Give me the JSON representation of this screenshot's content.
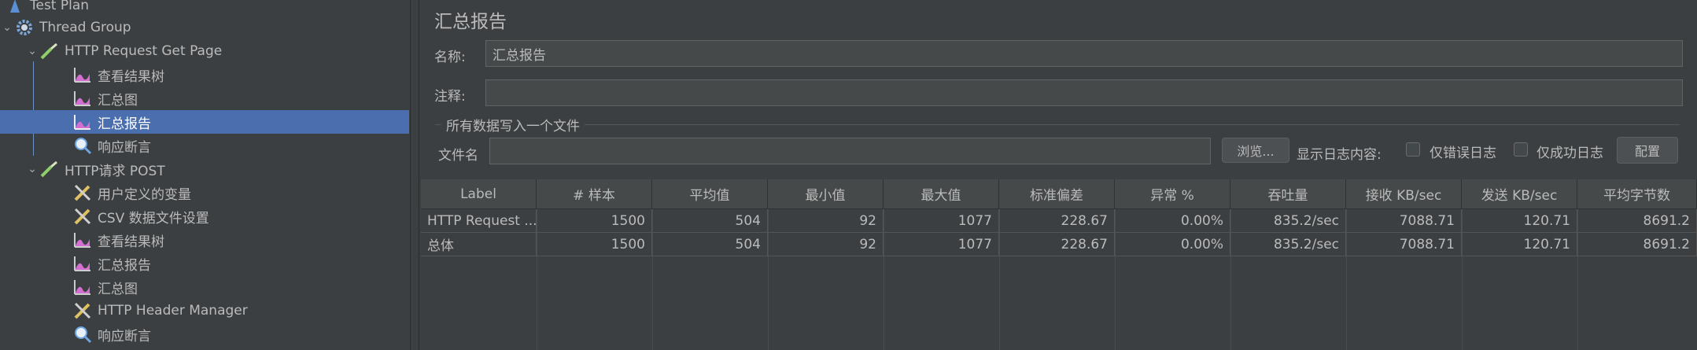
{
  "tree": {
    "items": [
      {
        "label": "Test Plan",
        "icon": "test-plan-icon"
      },
      {
        "label": "Thread Group",
        "icon": "gear-icon"
      },
      {
        "label": "HTTP Request Get Page",
        "icon": "pipette-icon"
      },
      {
        "label": "查看结果树",
        "icon": "graph-icon"
      },
      {
        "label": "汇总图",
        "icon": "graph-icon"
      },
      {
        "label": "汇总报告",
        "icon": "graph-icon"
      },
      {
        "label": "响应断言",
        "icon": "magnifier-icon"
      },
      {
        "label": "HTTP请求 POST",
        "icon": "pipette-icon"
      },
      {
        "label": "用户定义的变量",
        "icon": "wrench-icon"
      },
      {
        "label": "CSV 数据文件设置",
        "icon": "wrench-icon"
      },
      {
        "label": "查看结果树",
        "icon": "graph-icon"
      },
      {
        "label": "汇总报告",
        "icon": "graph-icon"
      },
      {
        "label": "汇总图",
        "icon": "graph-icon"
      },
      {
        "label": "HTTP Header Manager",
        "icon": "wrench-icon"
      },
      {
        "label": "响应断言",
        "icon": "magnifier-icon"
      }
    ],
    "selected_index": 5
  },
  "panel": {
    "title": "汇总报告",
    "name_label": "名称:",
    "name_value": "汇总报告",
    "comment_label": "注释:",
    "comment_value": "",
    "group_title": "所有数据写入一个文件",
    "file_label": "文件名",
    "file_value": "",
    "browse_button": "浏览...",
    "log_label": "显示日志内容:",
    "errors_only_label": "仅错误日志",
    "success_only_label": "仅成功日志",
    "config_button": "配置"
  },
  "table": {
    "headers": [
      "Label",
      "# 样本",
      "平均值",
      "最小值",
      "最大值",
      "标准偏差",
      "异常 %",
      "吞吐量",
      "接收 KB/sec",
      "发送 KB/sec",
      "平均字节数"
    ],
    "rows": [
      [
        "HTTP Request ...",
        "1500",
        "504",
        "92",
        "1077",
        "228.67",
        "0.00%",
        "835.2/sec",
        "7088.71",
        "120.71",
        "8691.2"
      ],
      [
        "总体",
        "1500",
        "504",
        "92",
        "1077",
        "228.67",
        "0.00%",
        "835.2/sec",
        "7088.71",
        "120.71",
        "8691.2"
      ]
    ]
  },
  "colors": {
    "background": "#3c3f41",
    "selection": "#4b6eaf",
    "text": "#bbbbbb"
  }
}
